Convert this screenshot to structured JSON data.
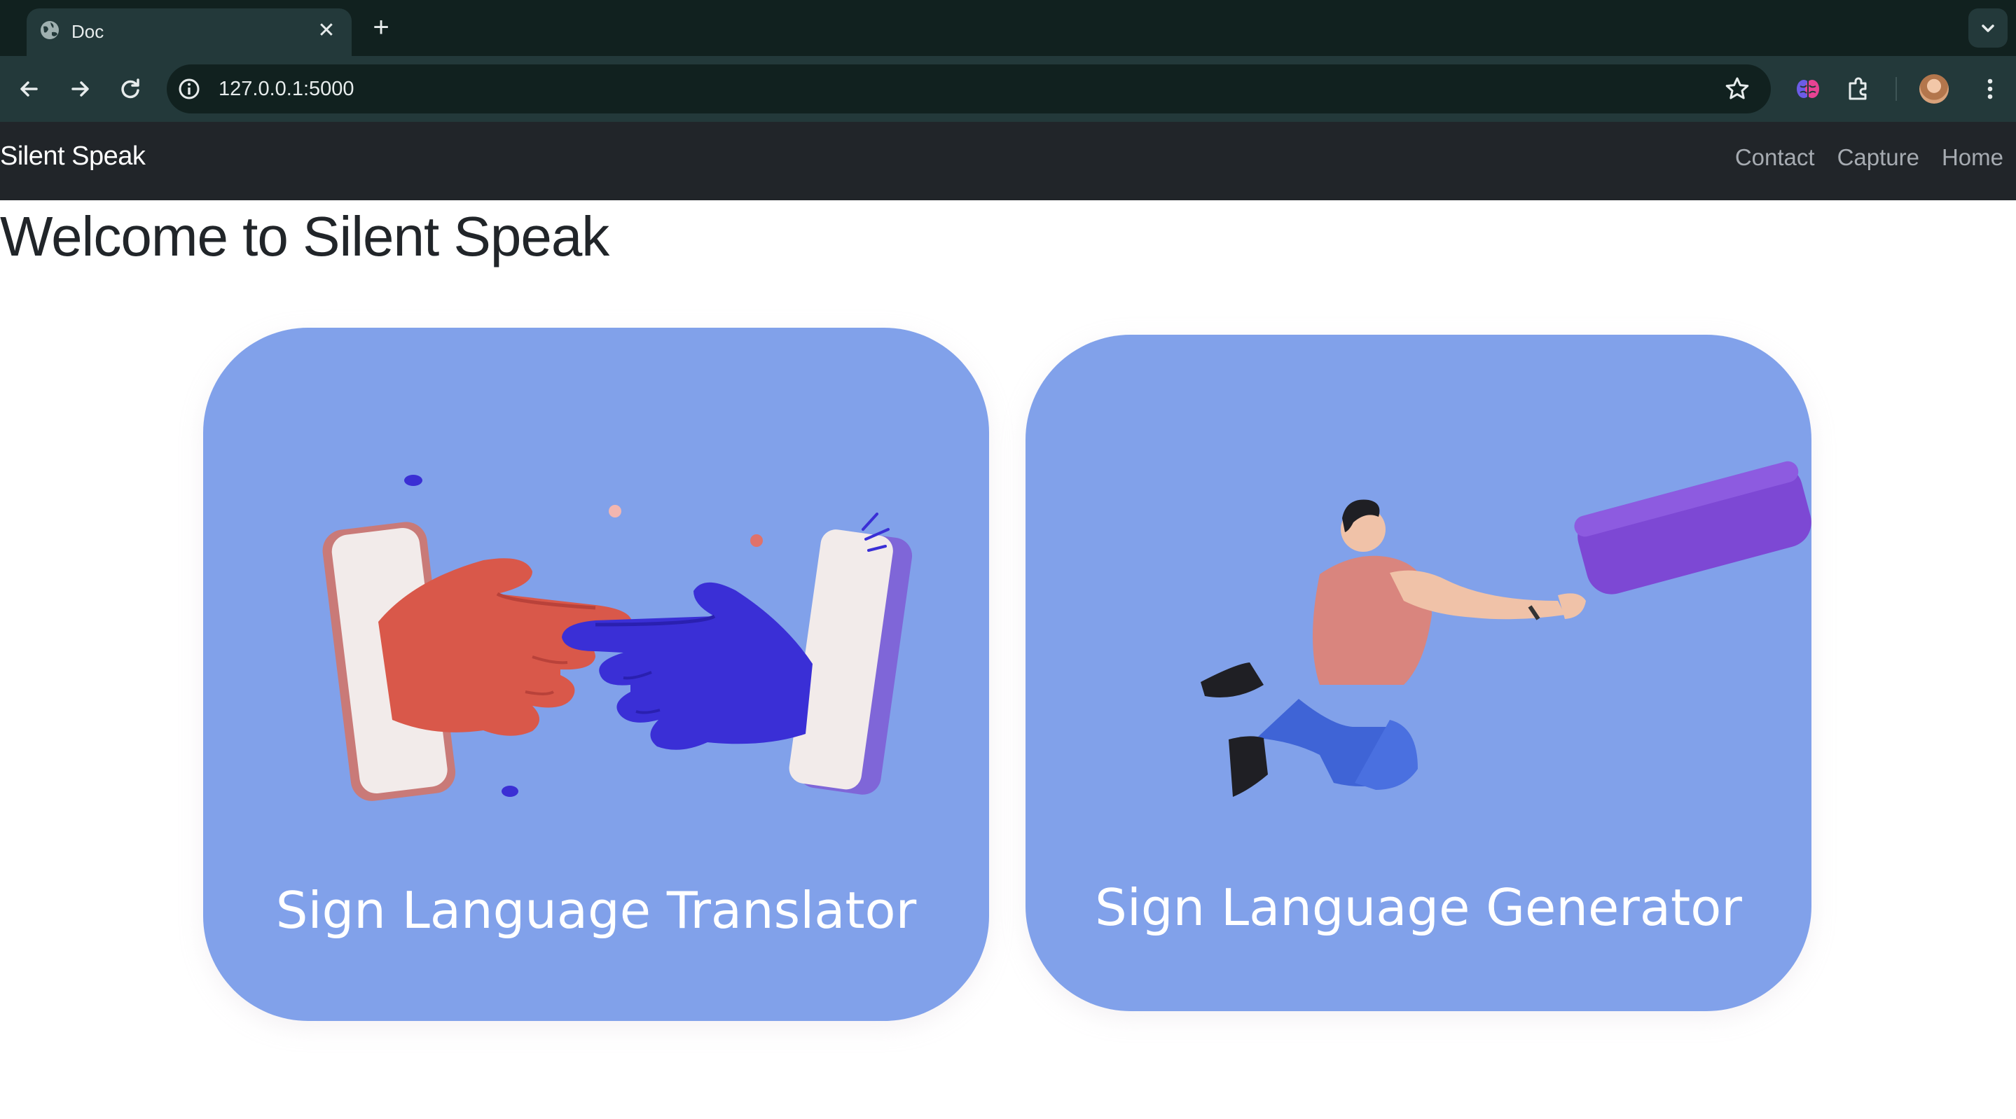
{
  "browser": {
    "tab_title": "Doc",
    "tab_close": "✕",
    "new_tab": "+",
    "url": "127.0.0.1:5000"
  },
  "navbar": {
    "brand": "Silent Speak",
    "links": [
      "Contact",
      "Capture",
      "Home"
    ]
  },
  "main": {
    "title": "Welcome to Silent Speak",
    "cards": [
      {
        "label": "Sign Language Translator",
        "icon": "two-hands-phones-illustration"
      },
      {
        "label": "Sign Language Generator",
        "icon": "floating-man-speech-bubble-illustration"
      }
    ]
  },
  "colors": {
    "card_bg": "#81a1ea",
    "navbar_bg": "#212529",
    "chrome_dark": "#11211f",
    "chrome_toolbar": "#23393a"
  }
}
